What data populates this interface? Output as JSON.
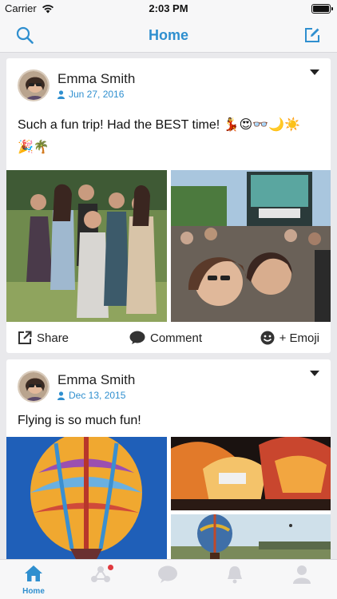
{
  "status_bar": {
    "carrier": "Carrier",
    "time": "2:03 PM"
  },
  "nav": {
    "title": "Home",
    "left_icon": "search-icon",
    "right_icon": "compose-icon"
  },
  "posts": [
    {
      "author": "Emma Smith",
      "date": "Jun 27, 2016",
      "text_main": "Such a fun trip! Had the BEST time! ",
      "emojis_line1": "💃😍👓🌙☀️",
      "emojis_line2": "🎉🌴",
      "photos": [
        "friends-outdoor-photo",
        "concert-crowd-photo"
      ],
      "actions": {
        "share": "Share",
        "comment": "Comment",
        "emoji": "+ Emoji"
      }
    },
    {
      "author": "Emma Smith",
      "date": "Dec 13, 2015",
      "text_main": "Flying is so much fun!",
      "photos": [
        "hot-air-balloon-sky-photo",
        "glowing-balloons-photo",
        "balloon-landscape-photo"
      ]
    }
  ],
  "tab_bar": {
    "items": [
      {
        "id": "home",
        "label": "Home",
        "icon": "home-icon",
        "active": true
      },
      {
        "id": "network",
        "label": "",
        "icon": "network-icon",
        "badge": true
      },
      {
        "id": "messages",
        "label": "",
        "icon": "chat-bubble-icon"
      },
      {
        "id": "notifications",
        "label": "",
        "icon": "bell-icon"
      },
      {
        "id": "profile",
        "label": "",
        "icon": "user-icon"
      }
    ]
  },
  "colors": {
    "accent": "#2f8fcf",
    "background": "#e9e9ec",
    "badge": "#e0393e"
  }
}
